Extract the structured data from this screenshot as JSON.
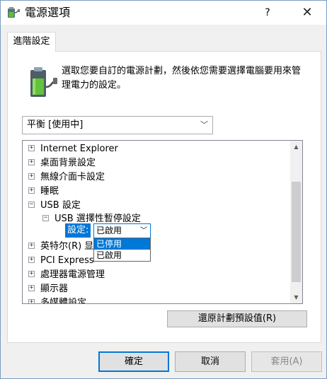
{
  "window": {
    "title": "電源選項",
    "help_label": "?",
    "close_label": "✕"
  },
  "tabs": [
    {
      "label": "進階設定"
    }
  ],
  "panel": {
    "description": "選取您要自訂的電源計劃，然後依您需要選擇電腦要用來管理電力的設定。",
    "plan_select": {
      "value": "平衡 [使用中]"
    },
    "tree": {
      "items": [
        {
          "toggle": "+",
          "label": "Internet Explorer"
        },
        {
          "toggle": "+",
          "label": "桌面背景設定"
        },
        {
          "toggle": "+",
          "label": "無線介面卡設定"
        },
        {
          "toggle": "+",
          "label": "睡眠"
        },
        {
          "toggle": "−",
          "label": "USB 設定"
        },
        {
          "toggle": "−",
          "label": "USB 選擇性暫停設定"
        },
        {
          "toggle": "+",
          "label": "英特尔(R) 显"
        },
        {
          "toggle": "+",
          "label": "PCI Express"
        },
        {
          "toggle": "+",
          "label": "處理器電源管理"
        },
        {
          "toggle": "+",
          "label": "顯示器"
        },
        {
          "toggle": "+",
          "label": "多媒體設定"
        }
      ],
      "setting": {
        "label": "設定:",
        "value": "已啟用",
        "options": [
          "已停用",
          "已啟用"
        ],
        "highlighted_option": "已停用"
      }
    },
    "restore_button": "還原計劃預設值(R)"
  },
  "footer": {
    "ok": "確定",
    "cancel": "取消",
    "apply": "套用(A)"
  },
  "colors": {
    "accent": "#0078d7",
    "window_border": "#7a9cc0"
  }
}
